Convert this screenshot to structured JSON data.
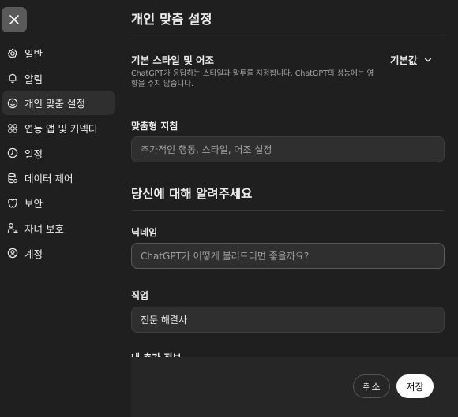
{
  "sidebar": {
    "close_icon": "close-icon",
    "items": [
      {
        "label": "일반",
        "icon": "gear-icon"
      },
      {
        "label": "알림",
        "icon": "bell-icon"
      },
      {
        "label": "개인 맞춤 설정",
        "icon": "personalization-icon",
        "active": true
      },
      {
        "label": "연동 앱 및 커넥터",
        "icon": "apps-grid-icon"
      },
      {
        "label": "일정",
        "icon": "clock-icon"
      },
      {
        "label": "데이터 제어",
        "icon": "database-icon"
      },
      {
        "label": "보안",
        "icon": "shield-icon"
      },
      {
        "label": "자녀 보호",
        "icon": "family-icon"
      },
      {
        "label": "계정",
        "icon": "account-icon"
      }
    ]
  },
  "main": {
    "title": "개인 맞춤 설정",
    "tone": {
      "label": "기본 스타일 및 어조",
      "description": "ChatGPT가 응답하는 스타일과 말투를 지정합니다. ChatGPT의 성능에는 영향을 주지 않습니다.",
      "selected": "기본값"
    },
    "custom_instructions": {
      "label": "맞춤형 지침",
      "placeholder": "추가적인 행동, 스타일, 어조 설정"
    },
    "about_section_title": "당신에 대해 알려주세요",
    "nickname": {
      "label": "닉네임",
      "placeholder": "ChatGPT가 어떻게 불러드리면 좋을까요?"
    },
    "occupation": {
      "label": "직업",
      "value": "전문 해결사"
    },
    "more_about_label": "내 추가 정보"
  },
  "footer": {
    "cancel_label": "취소",
    "save_label": "저장"
  },
  "colors": {
    "background": "#1f1f1f",
    "active_item": "#2f2f2f",
    "field_bg": "#2f2f2f",
    "save_button": "#ffffff"
  }
}
